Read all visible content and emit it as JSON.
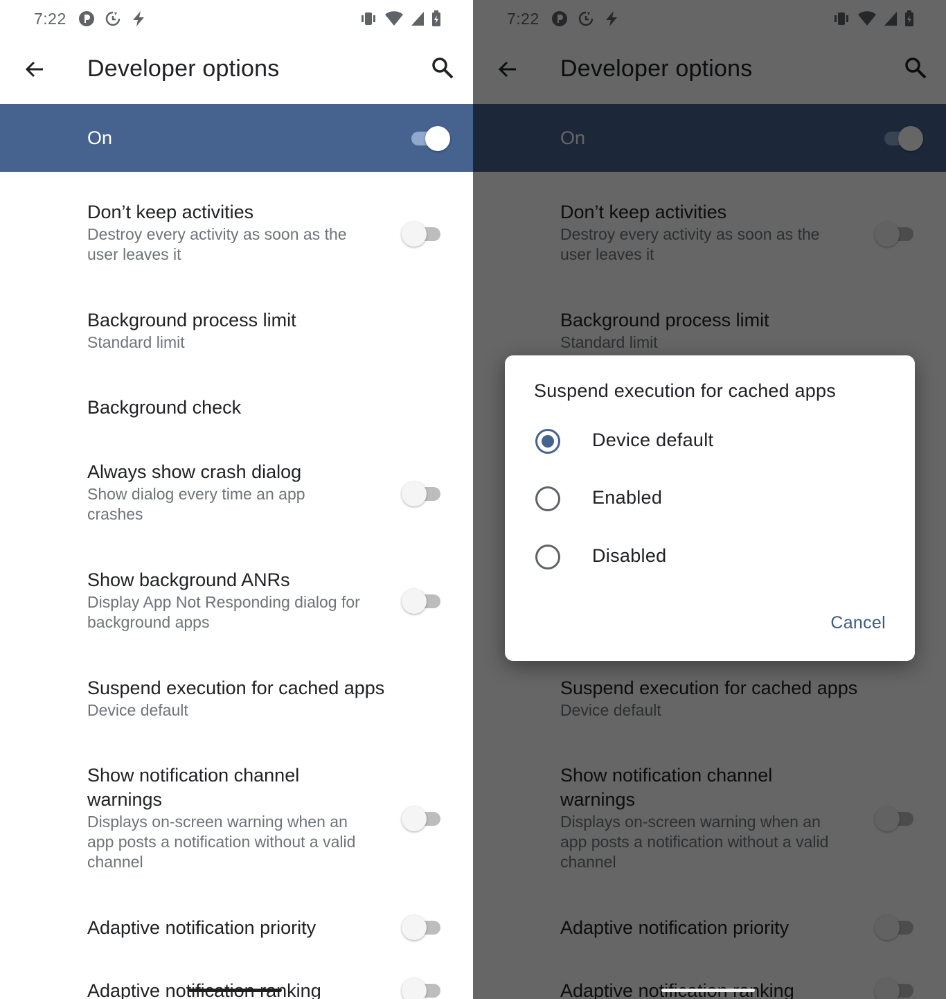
{
  "status_bar": {
    "time": "7:22"
  },
  "app_bar": {
    "title": "Developer options"
  },
  "master_switch": {
    "label": "On",
    "checked": true
  },
  "settings": [
    {
      "title": "Don’t keep activities",
      "summary": "Destroy every activity as soon as the user leaves it",
      "switch": true
    },
    {
      "title": "Background process limit",
      "summary": "Standard limit",
      "switch": false
    },
    {
      "title": "Background check",
      "summary": "",
      "switch": false
    },
    {
      "title": "Always show crash dialog",
      "summary": "Show dialog every time an app crashes",
      "switch": true
    },
    {
      "title": "Show background ANRs",
      "summary": "Display App Not Responding dialog for background apps",
      "switch": true
    },
    {
      "title": "Suspend execution for cached apps",
      "summary": "Device default",
      "switch": false
    },
    {
      "title": "Show notification channel warnings",
      "summary": "Displays on-screen warning when an app posts a notification without a valid channel",
      "switch": true
    },
    {
      "title": "Adaptive notification priority",
      "summary": "",
      "switch": true
    },
    {
      "title": "Adaptive notification ranking",
      "summary": "",
      "switch": true
    }
  ],
  "dialog": {
    "title": "Suspend execution for cached apps",
    "options": [
      {
        "label": "Device default",
        "selected": true
      },
      {
        "label": "Enabled",
        "selected": false
      },
      {
        "label": "Disabled",
        "selected": false
      }
    ],
    "cancel_label": "Cancel"
  },
  "colors": {
    "accent": "#46628e",
    "accent_text": "#3b5a85",
    "scrim": "rgba(0,0,0,0.6)"
  },
  "icons": [
    "blocked-notification-icon",
    "sync-icon",
    "charging-icon",
    "vibrate-icon",
    "wifi-icon",
    "cell-signal-icon",
    "battery-icon",
    "back-arrow-icon",
    "search-icon"
  ]
}
